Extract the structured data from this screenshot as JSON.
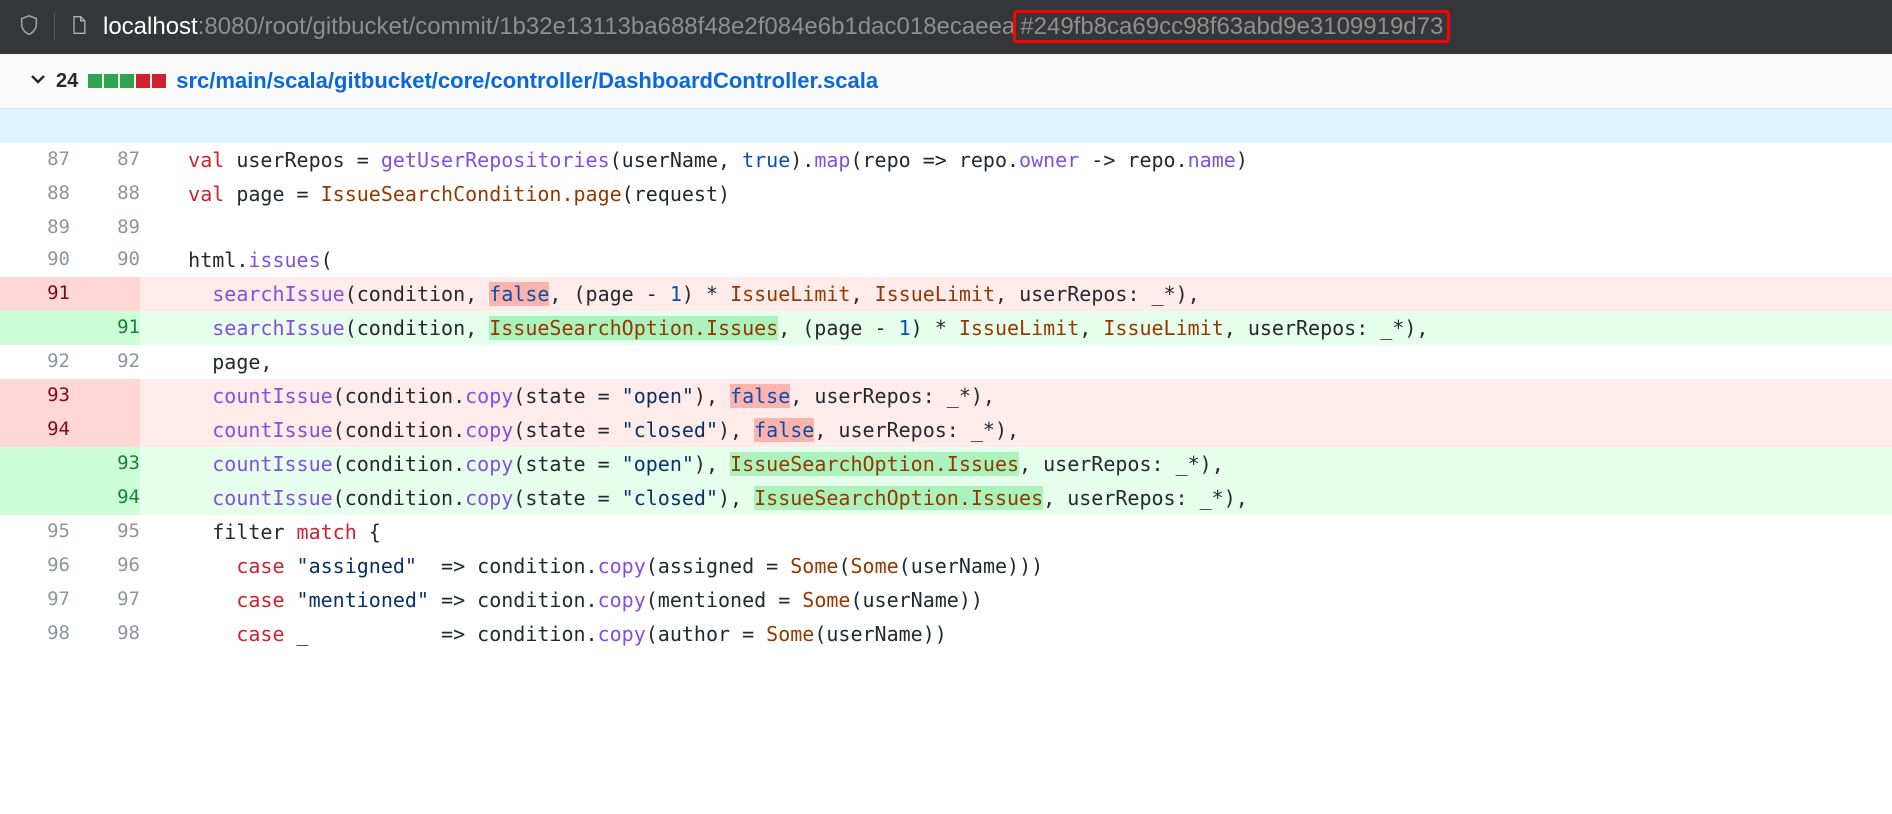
{
  "url": {
    "host": "localhost",
    "path": ":8080/root/gitbucket/commit/1b32e13113ba688f48e2f084e6b1dac018ecaeea",
    "hash": "#249fb8ca69cc98f63abd9e3109919d73"
  },
  "file_header": {
    "changes": "24",
    "additions_boxes": 3,
    "deletions_boxes": 2,
    "path": "src/main/scala/gitbucket/core/controller/DashboardController.scala"
  },
  "diff": [
    {
      "t": "hunk"
    },
    {
      "t": "ctx",
      "lo": "87",
      "ln": "87",
      "code": "    val userRepos = getUserRepositories(userName, true).map(repo => repo.owner -> repo.name)"
    },
    {
      "t": "ctx",
      "lo": "88",
      "ln": "88",
      "code": "    val page = IssueSearchCondition.page(request)"
    },
    {
      "t": "ctx",
      "lo": "89",
      "ln": "89",
      "code": ""
    },
    {
      "t": "ctx",
      "lo": "90",
      "ln": "90",
      "code": "    html.issues("
    },
    {
      "t": "del",
      "lo": "91",
      "ln": "",
      "code": "      searchIssue(condition, false, (page - 1) * IssueLimit, IssueLimit, userRepos: _*),"
    },
    {
      "t": "add",
      "lo": "",
      "ln": "91",
      "code": "      searchIssue(condition, IssueSearchOption.Issues, (page - 1) * IssueLimit, IssueLimit, userRepos: _*),"
    },
    {
      "t": "ctx",
      "lo": "92",
      "ln": "92",
      "code": "      page,"
    },
    {
      "t": "del",
      "lo": "93",
      "ln": "",
      "code": "      countIssue(condition.copy(state = \"open\"), false, userRepos: _*),"
    },
    {
      "t": "del",
      "lo": "94",
      "ln": "",
      "code": "      countIssue(condition.copy(state = \"closed\"), false, userRepos: _*),"
    },
    {
      "t": "add",
      "lo": "",
      "ln": "93",
      "code": "      countIssue(condition.copy(state = \"open\"), IssueSearchOption.Issues, userRepos: _*),"
    },
    {
      "t": "add",
      "lo": "",
      "ln": "94",
      "code": "      countIssue(condition.copy(state = \"closed\"), IssueSearchOption.Issues, userRepos: _*),"
    },
    {
      "t": "ctx",
      "lo": "95",
      "ln": "95",
      "code": "      filter match {"
    },
    {
      "t": "ctx",
      "lo": "96",
      "ln": "96",
      "code": "        case \"assigned\"  => condition.copy(assigned = Some(Some(userName)))"
    },
    {
      "t": "ctx",
      "lo": "97",
      "ln": "97",
      "code": "        case \"mentioned\" => condition.copy(mentioned = Some(userName))"
    },
    {
      "t": "ctx",
      "lo": "98",
      "ln": "98",
      "code": "        case _           => condition.copy(author = Some(userName))"
    }
  ],
  "highlight_rules": {
    "keywords": [
      "val",
      "case",
      "match",
      "true",
      "false"
    ],
    "word_del": "false",
    "word_add": "IssueSearchOption.Issues"
  }
}
